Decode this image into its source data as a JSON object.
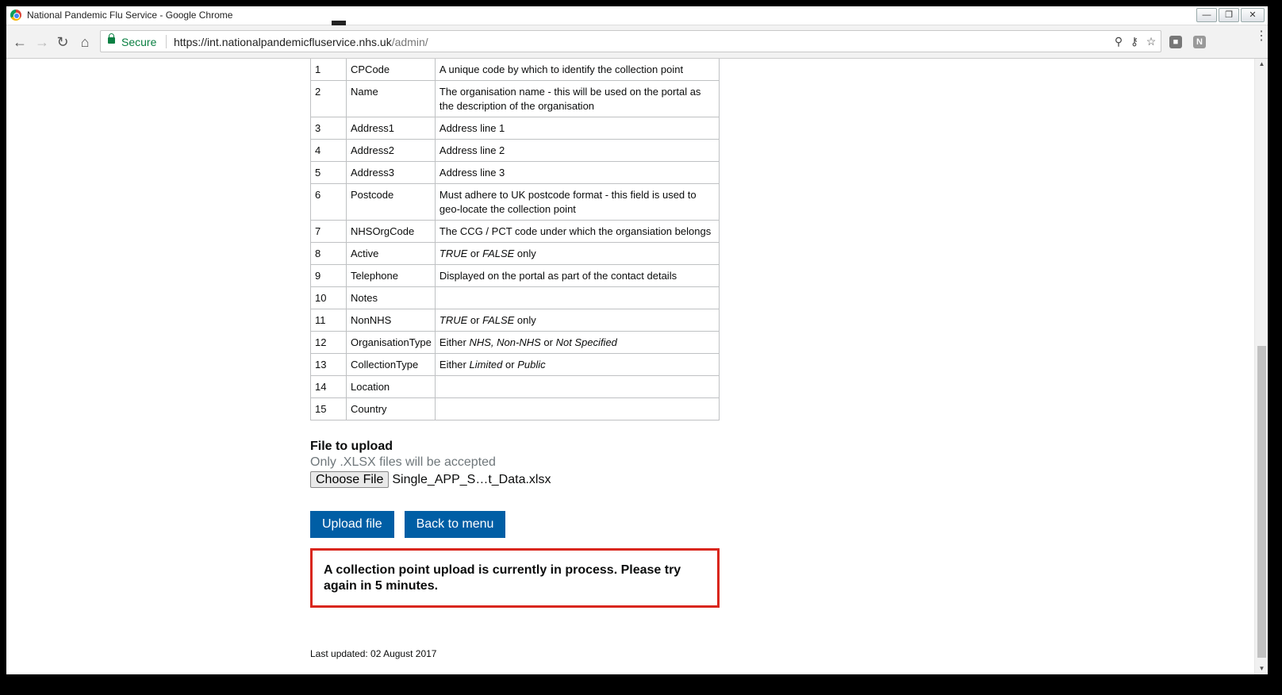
{
  "window": {
    "title": "National Pandemic Flu Service - Google Chrome"
  },
  "browser": {
    "secure_label": "Secure",
    "url_host": "https://int.nationalpandemicfluservice.nhs.uk",
    "url_path": "/admin/"
  },
  "table": {
    "rows": [
      {
        "n": "1",
        "field": "CPCode",
        "desc": "A unique code by which to identify the collection point"
      },
      {
        "n": "2",
        "field": "Name",
        "desc": "The organisation name - this will be used on the portal as the description of the organisation"
      },
      {
        "n": "3",
        "field": "Address1",
        "desc": "Address line 1"
      },
      {
        "n": "4",
        "field": "Address2",
        "desc": "Address line 2"
      },
      {
        "n": "5",
        "field": "Address3",
        "desc": "Address line 3"
      },
      {
        "n": "6",
        "field": "Postcode",
        "desc": "Must adhere to UK postcode format - this field is used to geo-locate the collection point"
      },
      {
        "n": "7",
        "field": "NHSOrgCode",
        "desc": "The CCG / PCT code under which the organsiation belongs"
      },
      {
        "n": "8",
        "field": "Active",
        "desc_parts": [
          {
            "t": "TRUE",
            "i": true
          },
          {
            "t": " or ",
            "i": false
          },
          {
            "t": "FALSE",
            "i": true
          },
          {
            "t": " only",
            "i": false
          }
        ]
      },
      {
        "n": "9",
        "field": "Telephone",
        "desc": "Displayed on the portal as part of the contact details"
      },
      {
        "n": "10",
        "field": "Notes",
        "desc": ""
      },
      {
        "n": "11",
        "field": "NonNHS",
        "desc_parts": [
          {
            "t": "TRUE",
            "i": true
          },
          {
            "t": " or ",
            "i": false
          },
          {
            "t": "FALSE",
            "i": true
          },
          {
            "t": " only",
            "i": false
          }
        ]
      },
      {
        "n": "12",
        "field": "OrganisationType",
        "desc_parts": [
          {
            "t": "Either ",
            "i": false
          },
          {
            "t": "NHS, Non-NHS",
            "i": true
          },
          {
            "t": " or ",
            "i": false
          },
          {
            "t": "Not Specified",
            "i": true
          }
        ]
      },
      {
        "n": "13",
        "field": "CollectionType",
        "desc_parts": [
          {
            "t": "Either ",
            "i": false
          },
          {
            "t": "Limited",
            "i": true
          },
          {
            "t": " or ",
            "i": false
          },
          {
            "t": "Public",
            "i": true
          }
        ]
      },
      {
        "n": "14",
        "field": "Location",
        "desc": ""
      },
      {
        "n": "15",
        "field": "Country",
        "desc": ""
      }
    ]
  },
  "upload": {
    "label": "File to upload",
    "hint": "Only .XLSX files will be accepted",
    "choose_button": "Choose File",
    "file_name": "Single_APP_S…t_Data.xlsx",
    "upload_button": "Upload file",
    "back_button": "Back to menu"
  },
  "error": {
    "message": "A collection point upload is currently in process. Please try again in 5 minutes."
  },
  "footer": {
    "last_updated": "Last updated: 02 August 2017"
  },
  "colors": {
    "nhs_blue": "#005ea5",
    "error_red": "#d9261c",
    "secure_green": "#0b8043"
  }
}
